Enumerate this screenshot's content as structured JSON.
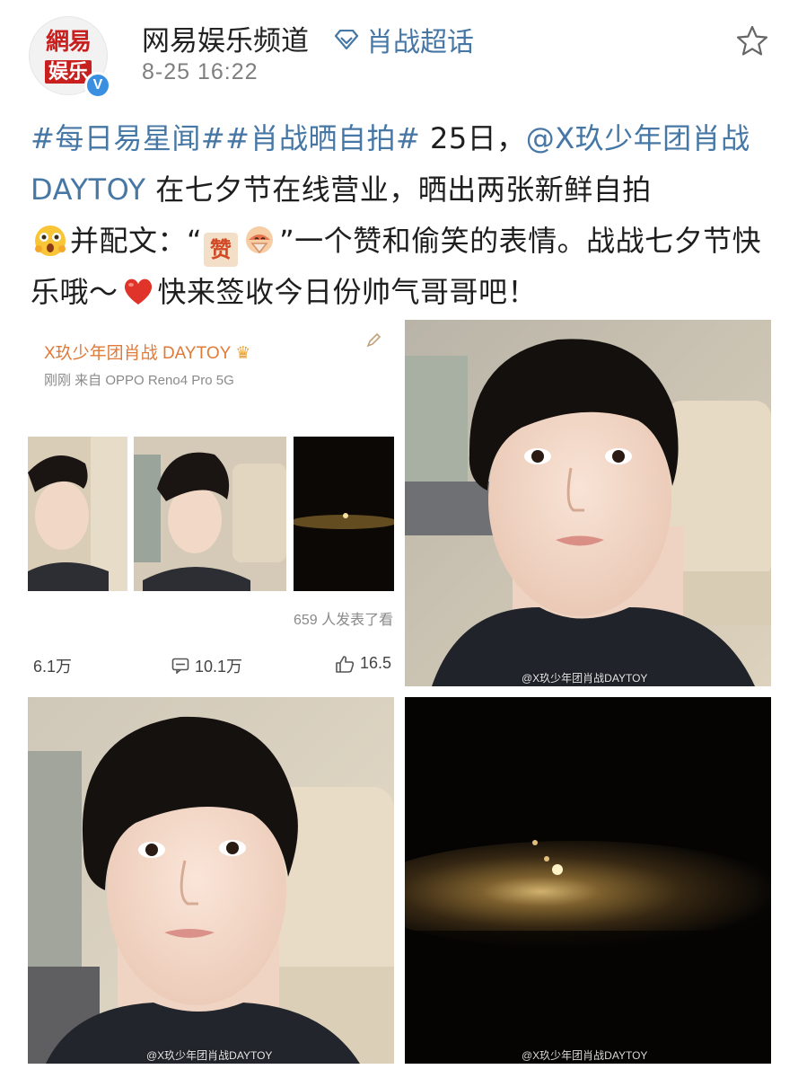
{
  "header": {
    "avatar_logo_line1": "網易",
    "avatar_logo_line2": "娱乐",
    "verified_mark": "V",
    "account_name": "网易娱乐频道",
    "topic_label": "肖战超话",
    "topic_icon": "diamond-icon",
    "post_time": "8-25 16:22",
    "favorite_icon": "star-icon"
  },
  "post": {
    "hashtag1": "#每日易星闻#",
    "hashtag2": "#肖战晒自拍#",
    "text_part1": " 25日，",
    "mention": "@X玖少年团肖战DAYTOY",
    "text_part2": " 在七夕节在线营业，晒出两张新鲜自拍",
    "text_part3": "并配文：“",
    "zan_emoji": "赞",
    "text_part4": "”一个赞和偷笑的表情。战战七夕节快乐哦～",
    "text_part5": "快来签收今日份帅气哥哥吧！",
    "emoji_names": [
      "surprised-emoji",
      "zan-emoji",
      "giggle-emoji",
      "heart-emoji"
    ]
  },
  "images": {
    "screenshot": {
      "author": "X玖少年团肖战 DAYTOY",
      "meta": "刚刚  来自 OPPO Reno4 Pro 5G",
      "reply_count": "659 人发表了看",
      "reposts": "6.1万",
      "comments": "10.1万",
      "likes": "16.5"
    },
    "watermark": "@X玖少年团肖战DAYTOY"
  },
  "colors": {
    "link": "#4677a5",
    "brand_red": "#c8201f",
    "verified_blue": "#3a8fe0",
    "screenshot_author": "#e07a39"
  }
}
